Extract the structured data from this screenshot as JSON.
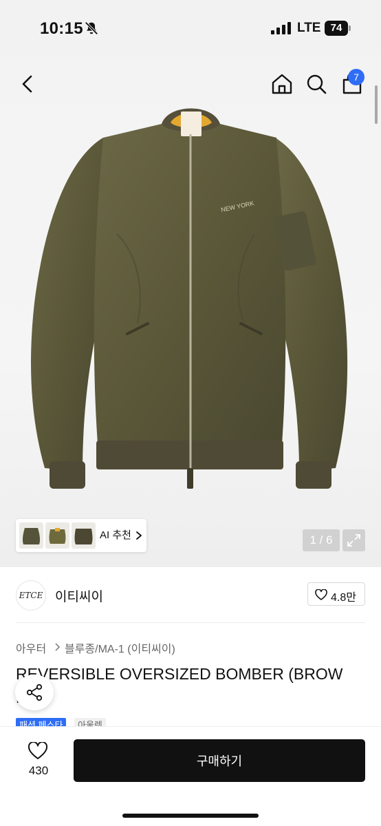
{
  "status_bar": {
    "time": "10:15",
    "network": "LTE",
    "battery": "74",
    "icons": [
      "bell-off-icon",
      "signal-icon",
      "battery-icon"
    ]
  },
  "header": {
    "icons": [
      "back-icon",
      "home-icon",
      "search-icon",
      "shopping-bag-icon"
    ],
    "cart_count": "7"
  },
  "gallery": {
    "ai_recommend_label": "AI 추천",
    "page_indicator": "1 / 6",
    "thumbnail_count": 3
  },
  "seller": {
    "logo_text": "ETCE",
    "name": "이티씨이",
    "likes": "4.8만"
  },
  "breadcrumb": {
    "category": "아우터",
    "subcategory": "블루종/MA-1 (이티씨이)"
  },
  "product": {
    "title_line1": "REVERSIBLE OVERSIZED BOMBER (BROW",
    "title_line2": "N)"
  },
  "tags": {
    "promo": "패션 페스타",
    "outlet": "아울렛"
  },
  "bottom_bar": {
    "wish_count": "430",
    "buy_label": "구매하기"
  },
  "colors": {
    "accent": "#2f6df6",
    "primary_button": "#111111",
    "jacket": "#5e5b3c"
  }
}
